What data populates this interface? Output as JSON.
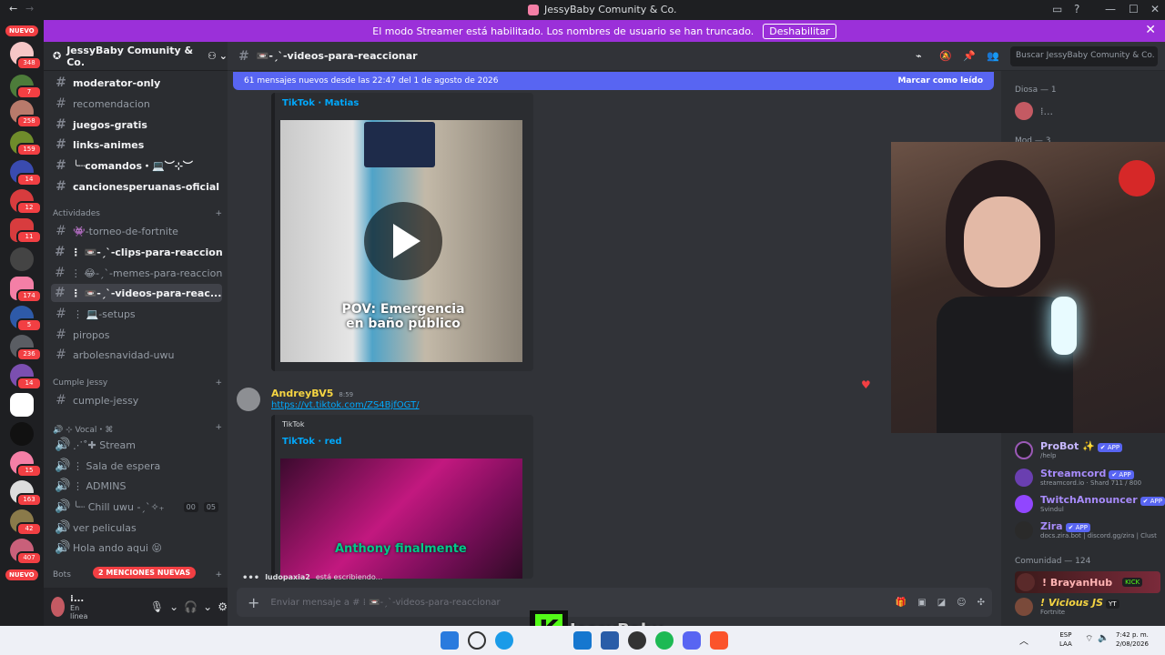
{
  "window": {
    "title": "JessyBaby Comunity & Co."
  },
  "banner": {
    "text": "El modo Streamer está habilitado. Los nombres de usuario se han truncado.",
    "button": "Deshabilitar"
  },
  "rail": {
    "nuevo_top": "NUEVO",
    "nuevo_bottom": "NUEVO",
    "badges": [
      "348",
      "7",
      "258",
      "159",
      "14",
      "12",
      "11",
      "174",
      "5",
      "236",
      "14",
      "15",
      "163",
      "42",
      "407"
    ]
  },
  "server": {
    "name": "JessyBaby Comunity & Co."
  },
  "channels": {
    "top": [
      {
        "name": "moderator-only",
        "unread": true
      },
      {
        "name": "recomendacion",
        "unread": false
      },
      {
        "name": "juegos-gratis",
        "unread": true
      },
      {
        "name": "links-animes",
        "unread": true
      },
      {
        "name": "╰┈comandos・💻︶⊹︶",
        "unread": true
      },
      {
        "name": "cancionesperuanas-oficial",
        "unread": true
      }
    ],
    "cat_actividades": "Actividades",
    "actividades": [
      {
        "name": "👾-torneo-de-fortnite",
        "unread": false
      },
      {
        "name": "⋮ 📼-ˏˋ-clips-para-reaccionar",
        "unread": true
      },
      {
        "name": "⋮ 😂-ˏˋ-memes-para-reaccionar",
        "unread": false
      },
      {
        "name": "⋮ 📼-ˏˋ-videos-para-reac...",
        "unread": true,
        "active": true
      },
      {
        "name": "⋮ 💻-setups",
        "unread": false
      },
      {
        "name": "piropos",
        "unread": false
      },
      {
        "name": "arbolesnavidad-uwu",
        "unread": false
      }
    ],
    "cat_cumple": "Cumple Jessy",
    "cumple": [
      {
        "name": "cumple-jessy"
      }
    ],
    "cat_vocal": "🔊 ⊹ Vocal・⌘",
    "vocal": [
      {
        "name": "⋰˚✚ Stream"
      },
      {
        "name": "⋮ Sala de espera"
      },
      {
        "name": "⋮ ADMINS"
      },
      {
        "name": "╰┈ Chill uwu -ˏˋ✧₊",
        "count_a": "00",
        "count_b": "05"
      },
      {
        "name": "ver peliculas"
      },
      {
        "name": "Hola ando aqui 😝"
      }
    ],
    "cat_bots": "Bots",
    "mentions": "2 MENCIONES NUEVAS"
  },
  "user": {
    "name": "⁞...",
    "status": "En línea"
  },
  "header": {
    "channel": "📼-ˏˋ-videos-para-reaccionar",
    "search_placeholder": "Buscar JessyBaby Comunity & Co."
  },
  "new_messages": {
    "text": "61 mensajes nuevos desde las 22:47 del 1 de agosto de 2026",
    "action": "Marcar como leído"
  },
  "messages": [
    {
      "embed_provider": "TikTok · Matias",
      "caption": "POV: Emergencia en baño público"
    },
    {
      "author": "AndreyBV5",
      "time": "8:59",
      "link": "https://vt.tiktok.com/ZS4BjfOGT/",
      "provider": "TikTok",
      "embed_provider": "TikTok · red",
      "caption": "Anthony finalmente"
    }
  ],
  "typing": {
    "user": "ludopaxia2",
    "text": "está escribiendo..."
  },
  "composer": {
    "placeholder": "Enviar mensaje a # ⁞ 📼-ˏˋ-videos-para-reaccionar"
  },
  "members": {
    "group_diosa": "Diosa — 1",
    "group_mod": "Mod — 3",
    "bots": [
      {
        "name": "ProBot ✨",
        "tag": "✔ APP",
        "sub": "/help",
        "color": "#c7b8ff"
      },
      {
        "name": "Streamcord",
        "tag": "✔ APP",
        "sub": "streamcord.io · Shard 711 / 800",
        "color": "#a78bfa"
      },
      {
        "name": "TwitchAnnouncer",
        "tag": "✔ APP",
        "sub": "Svindul",
        "color": "#a78bfa"
      },
      {
        "name": "Zira",
        "tag": "✔ APP",
        "sub": "docs.zira.bot | discord.gg/zira | Clust",
        "color": "#a78bfa"
      }
    ],
    "group_comunidad": "Comunidad — 124",
    "community": [
      {
        "name": "! BrayanHub",
        "tag": "KICK"
      },
      {
        "name": "! Vicious JS",
        "tag": "YT",
        "sub": "Fortnite"
      }
    ]
  },
  "overlay": {
    "brand": "JessyBaby",
    "logo_letter": "K"
  },
  "taskbar": {
    "lang": "ESP",
    "layout": "LAA",
    "time": "7:42 p. m.",
    "date": "2/08/2026"
  }
}
